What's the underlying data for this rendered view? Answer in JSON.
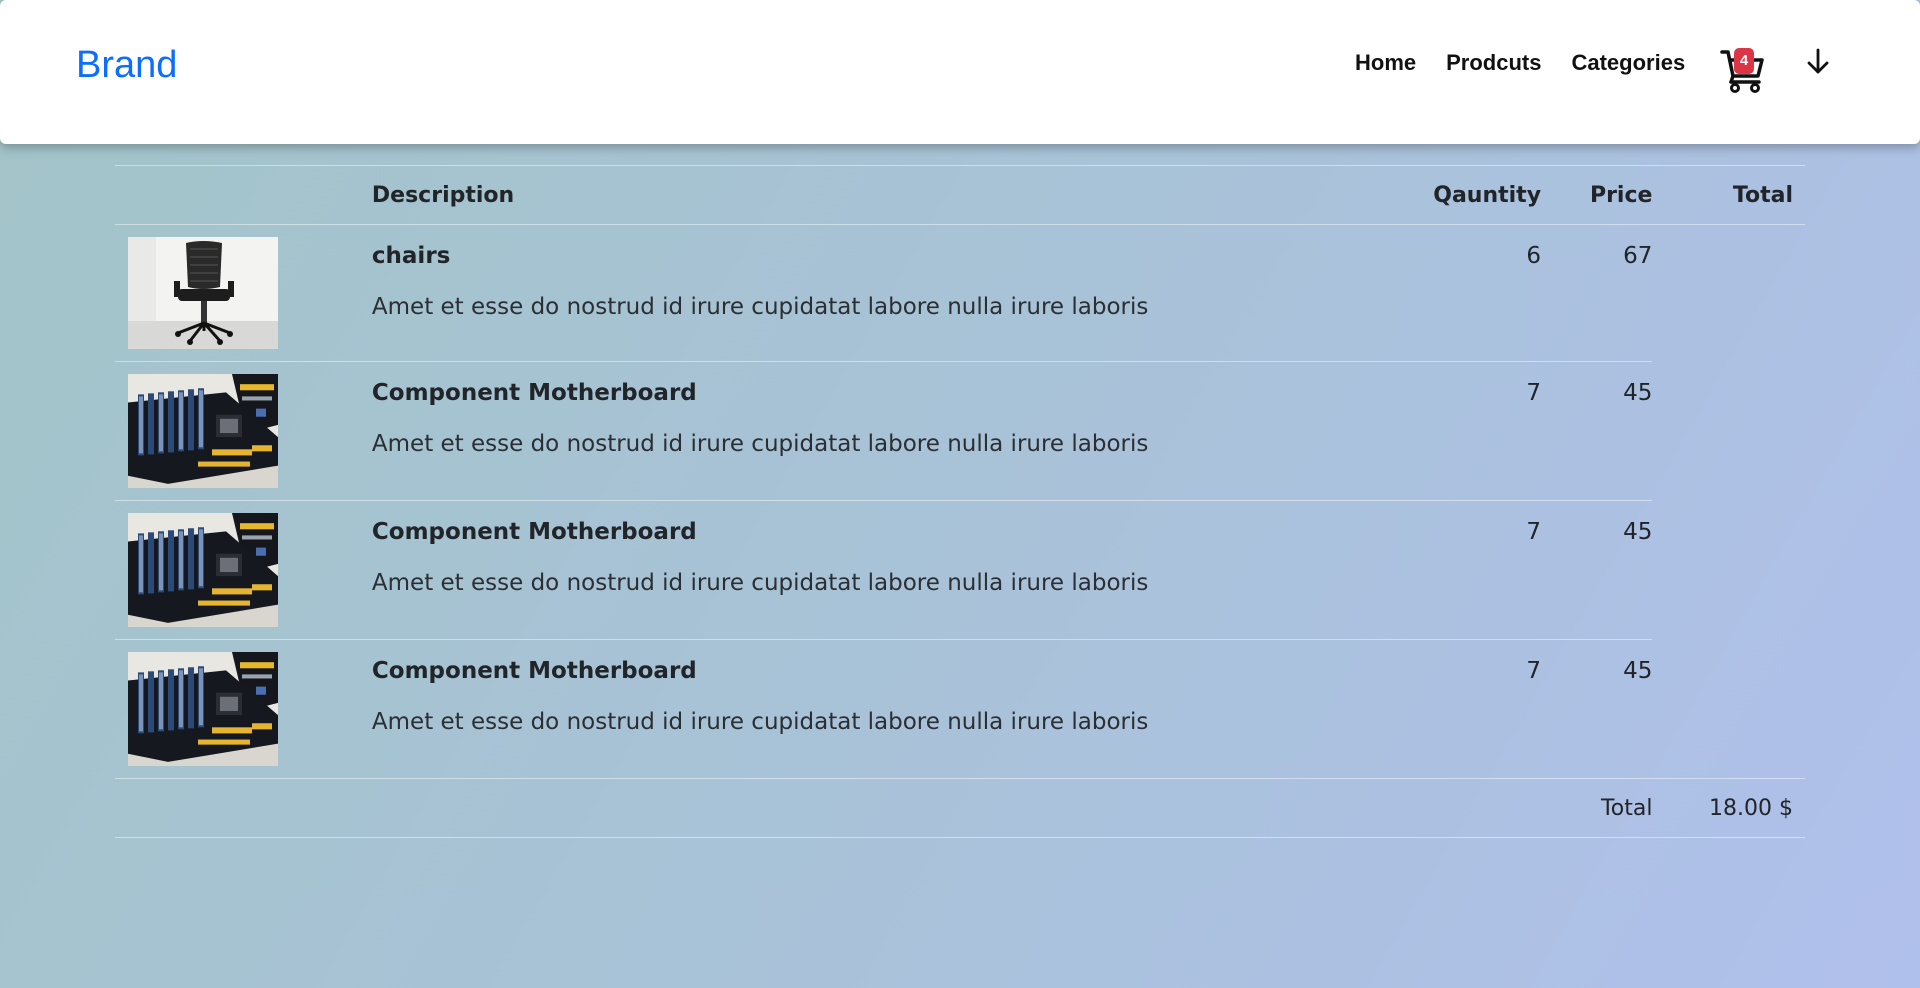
{
  "navbar": {
    "brand": "Brand",
    "links": [
      "Home",
      "Prodcuts",
      "Categories"
    ],
    "cart_count": "4",
    "accent_color": "#0d6efd",
    "badge_color": "#dc3545"
  },
  "table": {
    "headers": {
      "image": "",
      "description": "Description",
      "quantity": "Qauntity",
      "price": "Price",
      "total": "Total"
    },
    "rows": [
      {
        "title": "chairs",
        "description": "Amet et esse do nostrud id irure cupidatat labore nulla irure laboris",
        "quantity": "6",
        "price": "67",
        "image": "office-chair-photo"
      },
      {
        "title": "Component Motherboard",
        "description": "Amet et esse do nostrud id irure cupidatat labore nulla irure laboris",
        "quantity": "7",
        "price": "45",
        "image": "motherboard-photo"
      },
      {
        "title": "Component Motherboard",
        "description": "Amet et esse do nostrud id irure cupidatat labore nulla irure laboris",
        "quantity": "7",
        "price": "45",
        "image": "motherboard-photo"
      },
      {
        "title": "Component Motherboard",
        "description": "Amet et esse do nostrud id irure cupidatat labore nulla irure laboris",
        "quantity": "7",
        "price": "45",
        "image": "motherboard-photo"
      }
    ],
    "footer": {
      "label": "Total",
      "value": "18.00 $"
    }
  }
}
